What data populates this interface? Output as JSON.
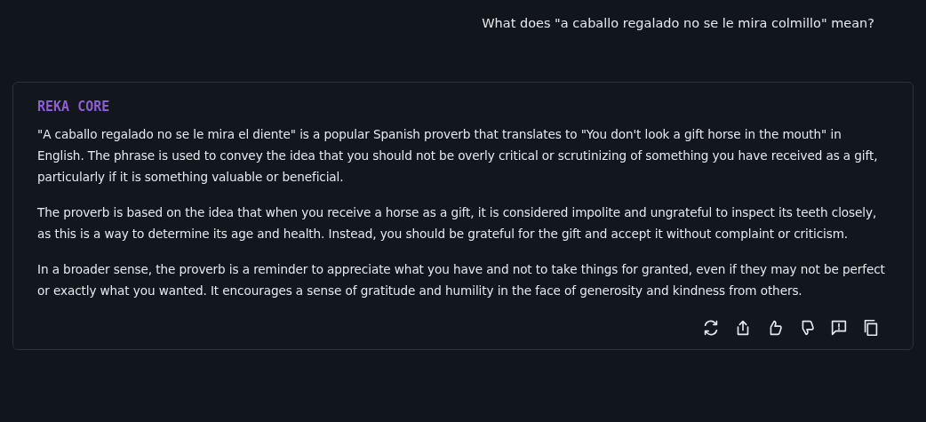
{
  "user_message": {
    "text": "What does \"a caballo regalado no se le mira colmillo\" mean?"
  },
  "response": {
    "model": "REKA CORE",
    "paragraphs": [
      "\"A caballo regalado no se le mira el diente\" is a popular Spanish proverb that translates to \"You don't look a gift horse in the mouth\" in English. The phrase is used to convey the idea that you should not be overly critical or scrutinizing of something you have received as a gift, particularly if it is something valuable or beneficial.",
      "The proverb is based on the idea that when you receive a horse as a gift, it is considered impolite and ungrateful to inspect its teeth closely, as this is a way to determine its age and health. Instead, you should be grateful for the gift and accept it without complaint or criticism.",
      "In a broader sense, the proverb is a reminder to appreciate what you have and not to take things for granted, even if they may not be perfect or exactly what you wanted. It encourages a sense of gratitude and humility in the face of generosity and kindness from others."
    ],
    "actions": [
      {
        "kind": "regenerate"
      },
      {
        "kind": "share"
      },
      {
        "kind": "like"
      },
      {
        "kind": "dislike"
      },
      {
        "kind": "report"
      },
      {
        "kind": "copy"
      }
    ]
  }
}
